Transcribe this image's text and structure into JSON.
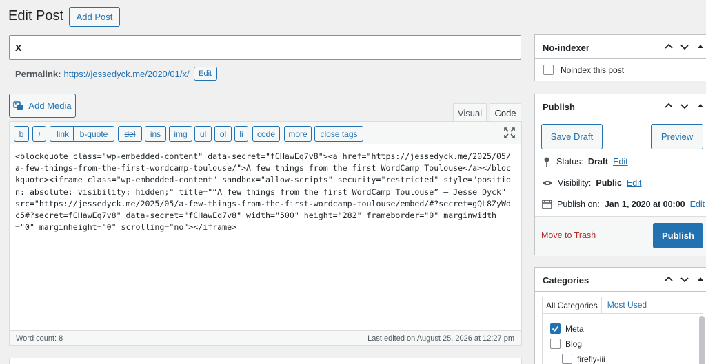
{
  "header": {
    "title": "Edit Post",
    "add_post": "Add Post"
  },
  "post": {
    "title_value": "x",
    "permalink_label": "Permalink:",
    "permalink_url": "https://jessedyck.me/2020/01/x/",
    "permalink_edit": "Edit"
  },
  "media": {
    "add_media": "Add Media"
  },
  "tabs": {
    "visual": "Visual",
    "code": "Code"
  },
  "toolbar": {
    "b": "b",
    "i": "i",
    "link": "link",
    "bquote": "b-quote",
    "del": "del",
    "ins": "ins",
    "img": "img",
    "ul": "ul",
    "ol": "ol",
    "li": "li",
    "code": "code",
    "more": "more",
    "close_tags": "close tags"
  },
  "editor": {
    "content": "<blockquote class=\"wp-embedded-content\" data-secret=\"fCHawEq7v8\"><a href=\"https://jessedyck.me/2025/05/a-few-things-from-the-first-wordcamp-toulouse/\">A few things from the first WordCamp Toulouse</a></blockquote><iframe class=\"wp-embedded-content\" sandbox=\"allow-scripts\" security=\"restricted\" style=\"position: absolute; visibility: hidden;\" title=\"“A few things from the first WordCamp Toulouse” — Jesse Dyck\" src=\"https://jessedyck.me/2025/05/a-few-things-from-the-first-wordcamp-toulouse/embed/#?secret=gQL8ZyWdc5#?secret=fCHawEq7v8\" data-secret=\"fCHawEq7v8\" width=\"500\" height=\"282\" frameborder=\"0\" marginwidth=\"0\" marginheight=\"0\" scrolling=\"no\"></iframe>",
    "word_count": "Word count: 8",
    "last_edited": "Last edited on August 25, 2026 at 12:27 pm"
  },
  "noindexer": {
    "title": "No-indexer",
    "checkbox_label": "Noindex this post"
  },
  "publish": {
    "title": "Publish",
    "save_draft": "Save Draft",
    "preview": "Preview",
    "status_label": "Status:",
    "status_value": "Draft",
    "visibility_label": "Visibility:",
    "visibility_value": "Public",
    "publish_on_label": "Publish on:",
    "publish_on_value": "Jan 1, 2020 at 00:00",
    "edit": "Edit",
    "trash": "Move to Trash",
    "publish_button": "Publish"
  },
  "categories": {
    "title": "Categories",
    "tab_all": "All Categories",
    "tab_most": "Most Used",
    "items": [
      {
        "label": "Meta",
        "checked": true
      },
      {
        "label": "Blog",
        "checked": false
      },
      {
        "label": "firefly-iii",
        "checked": false
      }
    ]
  },
  "colors": {
    "accent": "#2271b1",
    "danger": "#b32d2e",
    "background": "#f0f0f1"
  },
  "icons": [
    "add-media-icon",
    "fullscreen-icon",
    "chevron-up-icon",
    "chevron-down-icon",
    "arrow-up-icon",
    "pin-icon",
    "eye-icon",
    "calendar-icon",
    "checkmark-icon"
  ]
}
